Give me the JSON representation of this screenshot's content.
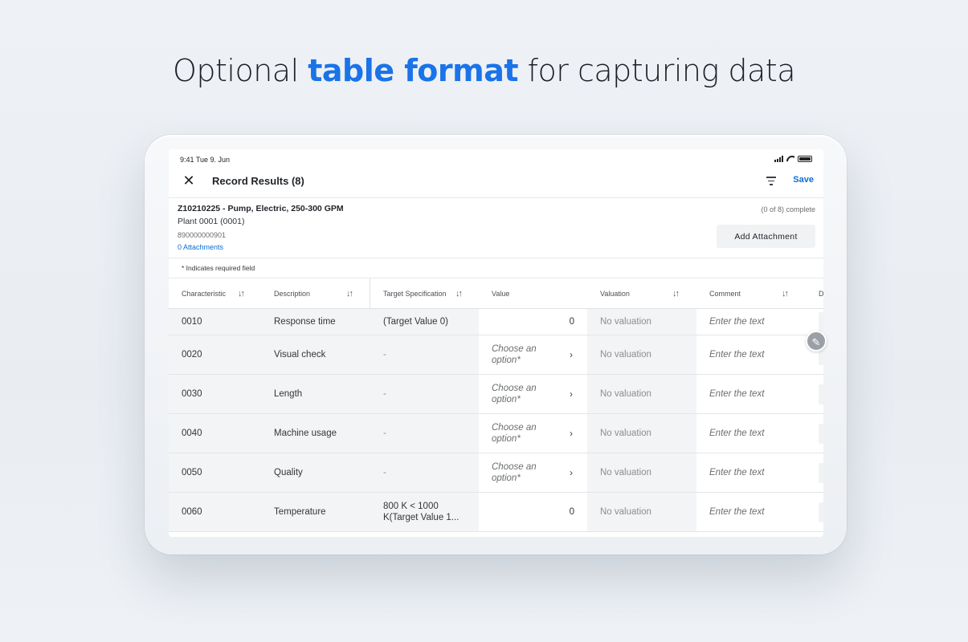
{
  "headline": {
    "prefix": "Optional ",
    "accent": "table format",
    "suffix": " for capturing data"
  },
  "status": {
    "time": "9:41  Tue 9. Jun"
  },
  "header": {
    "title": "Record Results (8)",
    "save_label": "Save"
  },
  "object": {
    "title": "Z10210225 - Pump, Electric, 250-300 GPM",
    "plant": "Plant 0001 (0001)",
    "number": "890000000901",
    "attachments_link": "0 Attachments",
    "progress": "(0 of 8) complete",
    "add_attachment_label": "Add Attachment"
  },
  "required_note": "* Indicates required field",
  "columns": {
    "characteristic": "Characteristic",
    "description": "Description",
    "target": "Target Specification",
    "value": "Value",
    "valuation": "Valuation",
    "comment": "Comment",
    "next": "D"
  },
  "rows": [
    {
      "characteristic": "0010",
      "description": "Response time",
      "target": "(Target Value 0)",
      "value": "0",
      "valuation": "No valuation",
      "comment": "Enter the text"
    },
    {
      "characteristic": "0020",
      "description": "Visual check",
      "target": "-",
      "value_choose_1": "Choose an",
      "value_choose_2": "option*",
      "valuation": "No valuation",
      "comment": "Enter the text"
    },
    {
      "characteristic": "0030",
      "description": "Length",
      "target": "-",
      "value_choose_1": "Choose an",
      "value_choose_2": "option*",
      "valuation": "No valuation",
      "comment": "Enter the text"
    },
    {
      "characteristic": "0040",
      "description": "Machine usage",
      "target": "-",
      "value_choose_1": "Choose an",
      "value_choose_2": "option*",
      "valuation": "No valuation",
      "comment": "Enter the text"
    },
    {
      "characteristic": "0050",
      "description": "Quality",
      "target": "-",
      "value_choose_1": "Choose an",
      "value_choose_2": "option*",
      "valuation": "No valuation",
      "comment": "Enter the text"
    },
    {
      "characteristic": "0060",
      "description": "Temperature",
      "target_line1": "800 K < 1000",
      "target_line2": "K(Target Value 1...",
      "value": "0",
      "valuation": "No valuation",
      "comment": "Enter the text"
    }
  ],
  "icons": {
    "close": "close-icon",
    "filter": "filter-icon",
    "sort": "sort-icon",
    "chevron": "chevron-right-icon",
    "edit": "pencil-icon"
  }
}
